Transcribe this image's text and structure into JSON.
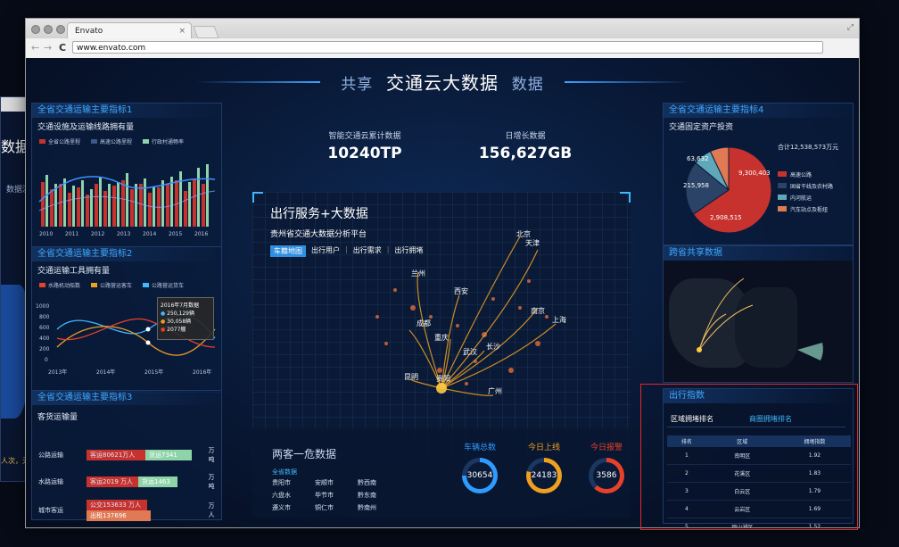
{
  "bg_window": {
    "title_partial": "数据用",
    "sub_partial": "数据流",
    "bottom_partial": "人次，无"
  },
  "browser": {
    "tab_title": "Envato",
    "tab_close": "×",
    "url": "www.envato.com",
    "back": "←",
    "forward": "→",
    "reload": "C"
  },
  "header": {
    "pre": "共享",
    "main": "交通云大数据",
    "post": "数据"
  },
  "panel1": {
    "title": "全省交通运输主要指标1",
    "subtitle": "交通设施及运输线路拥有量",
    "legend": [
      "全省公路里程",
      "高速公路里程",
      "行政村通畅率"
    ],
    "years": [
      "2010",
      "2011",
      "2012",
      "2013",
      "2014",
      "2015",
      "2016"
    ]
  },
  "panel2": {
    "title": "全省交通运输主要指标2",
    "subtitle": "交通运输工具拥有量",
    "legend": [
      "水路机动船数",
      "公路营运客车",
      "公路营运货车"
    ],
    "yticks": [
      "1000",
      "800",
      "600",
      "400",
      "200",
      "0"
    ],
    "xticks": [
      "2013年",
      "2014年",
      "2015年",
      "2016年"
    ],
    "tooltip": {
      "title": "2016年7月数据",
      "rows": [
        "250,129辆",
        "30,058辆",
        "2077艘"
      ]
    }
  },
  "panel3": {
    "title": "全省交通运输主要指标3",
    "subtitle": "客货运输量",
    "rows": [
      {
        "label": "公路运输",
        "red": "客运80621万人",
        "green": "货运7341",
        "unit": "万吨"
      },
      {
        "label": "水路运输",
        "red": "客运2019 万人",
        "green": "货运1463",
        "unit": "万吨"
      },
      {
        "label": "城市客运",
        "red": "公交153633 万人",
        "green": "出租137696",
        "unit": "万人"
      }
    ]
  },
  "stats": {
    "left_label": "智能交通云累计数据",
    "left_value": "10240TP",
    "right_label": "日增长数据",
    "right_value": "156,627GB"
  },
  "map": {
    "title": "出行服务+大数据",
    "subtitle": "贵州省交通大数据分析平台",
    "tabs": [
      "车籍地图",
      "出行用户",
      "出行需求",
      "出行拥堵"
    ],
    "cities": [
      "北京",
      "天津",
      "兰州",
      "西安",
      "南京",
      "上海",
      "成都",
      "重庆",
      "武汉",
      "长沙",
      "贵阳",
      "昆明",
      "广州"
    ]
  },
  "bottom": {
    "title": "两客一危数据",
    "tab": "全省数据",
    "cities": [
      "贵阳市",
      "安顺市",
      "黔西南",
      "六盘水",
      "毕节市",
      "黔东南",
      "遵义市",
      "铜仁市",
      "黔南州"
    ],
    "kpis": [
      {
        "label": "车辆总数",
        "value": "30654",
        "color": "#2f9bff"
      },
      {
        "label": "今日上线",
        "value": "24183",
        "color": "#f0a020"
      },
      {
        "label": "今日报警",
        "value": "3586",
        "color": "#e8412a"
      }
    ]
  },
  "panel4": {
    "title": "全省交通运输主要指标4",
    "subtitle": "交通固定资产投资",
    "total": "合计12,538,573万元",
    "slice_labels": [
      "9,300,403",
      "2,908,515",
      "215,958",
      "63,632"
    ],
    "legend": [
      "高速公路",
      "国省干线及农村路",
      "内河航运",
      "汽车站点及枢纽"
    ],
    "colors": [
      "#c7322e",
      "#2c4368",
      "#5fa8b9",
      "#e07a55"
    ]
  },
  "chart_data": {
    "type": "pie",
    "title": "交通固定资产投资",
    "categories": [
      "高速公路",
      "国省干线及农村路",
      "内河航运",
      "汽车站点及枢纽"
    ],
    "values": [
      9300403,
      2908515,
      215958,
      63632
    ]
  },
  "cross": {
    "title": "跨省共享数据"
  },
  "travel": {
    "title": "出行指数",
    "tab_active": "区域拥堵排名",
    "tab_other": "商圈拥堵排名",
    "headers": [
      "排名",
      "区域",
      "拥堵指数"
    ],
    "rows": [
      [
        "1",
        "南明区",
        "1.92"
      ],
      [
        "2",
        "花溪区",
        "1.83"
      ],
      [
        "3",
        "白云区",
        "1.79"
      ],
      [
        "4",
        "云岩区",
        "1.69"
      ],
      [
        "5",
        "观山湖区",
        "1.52"
      ]
    ]
  }
}
